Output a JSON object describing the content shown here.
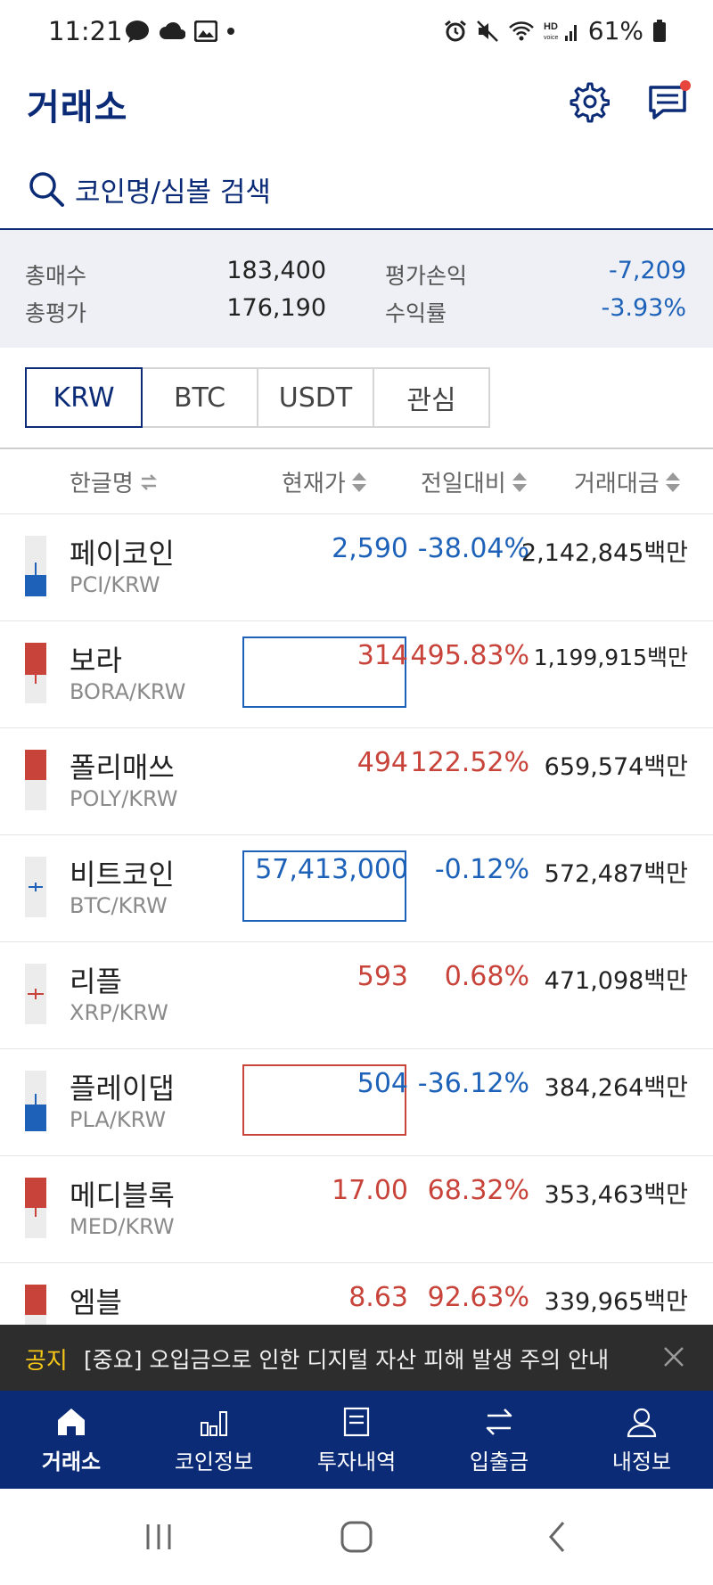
{
  "status_bar": {
    "time": "11:21",
    "battery": "61%"
  },
  "header": {
    "title": "거래소",
    "settings_icon": "gear-icon",
    "chat_icon": "chat-icon"
  },
  "search": {
    "placeholder": "코인명/심볼 검색"
  },
  "summary": {
    "total_buy_label": "총매수",
    "total_buy_value": "183,400",
    "total_eval_label": "총평가",
    "total_eval_value": "176,190",
    "pnl_label": "평가손익",
    "pnl_value": "-7,209",
    "return_label": "수익률",
    "return_value": "-3.93%"
  },
  "tabs": [
    "KRW",
    "BTC",
    "USDT",
    "관심"
  ],
  "columns": {
    "name": "한글명",
    "price": "현재가",
    "change": "전일대비",
    "volume": "거래대금"
  },
  "rows": [
    {
      "name": "페이코인",
      "symbol": "PCI/KRW",
      "price": "2,590",
      "change": "-38.04%",
      "volume": "2,142,845백만",
      "dir": "down"
    },
    {
      "name": "보라",
      "symbol": "BORA/KRW",
      "price": "314",
      "change": "495.83%",
      "volume": "1,199,915백만",
      "dir": "up"
    },
    {
      "name": "폴리매쓰",
      "symbol": "POLY/KRW",
      "price": "494",
      "change": "122.52%",
      "volume": "659,574백만",
      "dir": "up"
    },
    {
      "name": "비트코인",
      "symbol": "BTC/KRW",
      "price": "57,413,000",
      "change": "-0.12%",
      "volume": "572,487백만",
      "dir": "down"
    },
    {
      "name": "리플",
      "symbol": "XRP/KRW",
      "price": "593",
      "change": "0.68%",
      "volume": "471,098백만",
      "dir": "up"
    },
    {
      "name": "플레이댑",
      "symbol": "PLA/KRW",
      "price": "504",
      "change": "-36.12%",
      "volume": "384,264백만",
      "dir": "down"
    },
    {
      "name": "메디블록",
      "symbol": "MED/KRW",
      "price": "17.00",
      "change": "68.32%",
      "volume": "353,463백만",
      "dir": "up"
    },
    {
      "name": "엠블",
      "symbol": "",
      "price": "8.63",
      "change": "92.63%",
      "volume": "339,965백만",
      "dir": "up"
    }
  ],
  "notice": {
    "tag": "공지",
    "text": "[중요] 오입금으로 인한 디지털 자산 피해 발생 주의 안내"
  },
  "bottom_nav": [
    "거래소",
    "코인정보",
    "투자내역",
    "입출금",
    "내정보"
  ],
  "colors": {
    "brand": "#0b2b77",
    "up": "#c8433a",
    "down": "#1d62b8",
    "notice_tag": "#f5c518"
  }
}
